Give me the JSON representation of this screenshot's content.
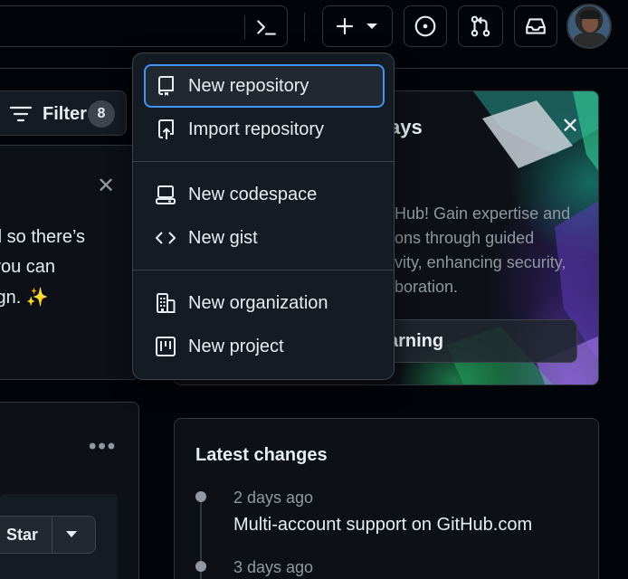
{
  "header": {
    "command_palette_icon": "terminal-icon",
    "create_button_icon": "plus-icon",
    "issues_icon": "issue-opened-icon",
    "pull_requests_icon": "git-pull-request-icon",
    "inbox_icon": "inbox-icon",
    "avatar_alt": "User avatar"
  },
  "filter": {
    "label": "Filter",
    "count": "8"
  },
  "left_card": {
    "line1": "d so there’s",
    "line2": " you can",
    "line3": "ign. ✨"
  },
  "left_card2": {
    "more": "•••",
    "star_label": "Star"
  },
  "promo": {
    "title_fragment": "ays",
    "lines": [
      "Hub! Gain expertise and",
      "ons through guided",
      "vity, enhancing security,",
      "boration."
    ],
    "button_label": "arning"
  },
  "latest": {
    "title": "Latest changes",
    "items": [
      {
        "date": "2 days ago",
        "title": "Multi-account support on GitHub.com"
      },
      {
        "date": "3 days ago",
        "title": ""
      }
    ]
  },
  "menu": {
    "items": [
      {
        "label": "New repository",
        "icon": "repo-icon"
      },
      {
        "label": "Import repository",
        "icon": "repo-push-icon"
      },
      {
        "label": "New codespace",
        "icon": "codespaces-icon"
      },
      {
        "label": "New gist",
        "icon": "code-icon"
      },
      {
        "label": "New organization",
        "icon": "organization-icon"
      },
      {
        "label": "New project",
        "icon": "project-icon"
      }
    ]
  },
  "colors": {
    "background": "#010409",
    "surface": "#151b23",
    "border": "#30363d",
    "focus_ring": "#4493f8",
    "text": "#e6edf3",
    "muted": "#9198a1"
  }
}
